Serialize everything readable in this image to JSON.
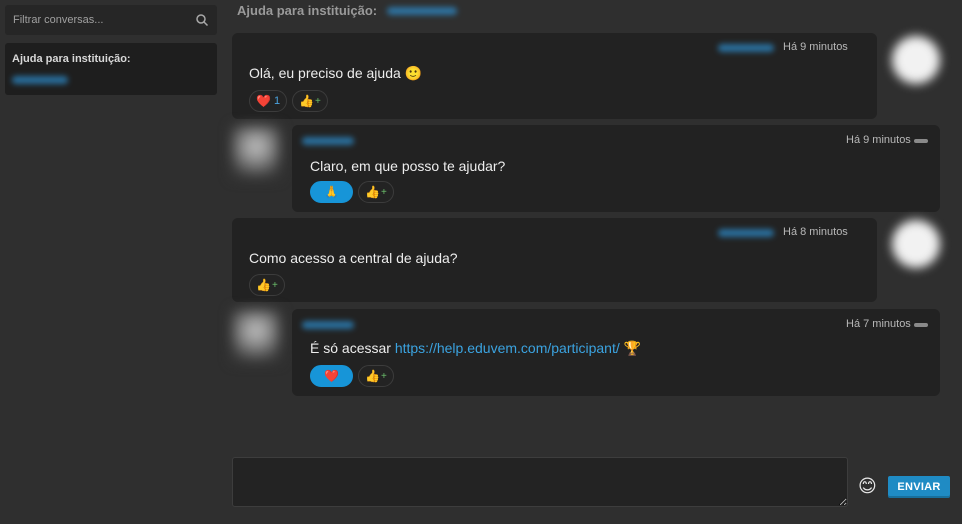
{
  "sidebar": {
    "search_placeholder": "Filtrar conversas...",
    "conversations": [
      {
        "title": "Ajuda para instituição:"
      }
    ]
  },
  "header": {
    "title": "Ajuda para instituição:"
  },
  "messages": [
    {
      "side": "right",
      "time": "Há 9 minutos",
      "text": "Olá, eu preciso de ajuda 🙂",
      "reactions": [
        {
          "emoji": "❤️",
          "count": "1",
          "active": false
        },
        {
          "emoji": "👍",
          "plus": "+",
          "active": false
        }
      ]
    },
    {
      "side": "left",
      "time": "Há 9 minutos",
      "text": "Claro, em que posso te ajudar?",
      "reactions": [
        {
          "emoji": "🙏",
          "active": true
        },
        {
          "emoji": "👍",
          "plus": "+",
          "active": false
        }
      ]
    },
    {
      "side": "right",
      "time": "Há 8 minutos",
      "text": "Como acesso a central de ajuda?",
      "reactions": [
        {
          "emoji": "👍",
          "plus": "+",
          "active": false
        }
      ]
    },
    {
      "side": "left",
      "time": "Há 7 minutos",
      "text_prefix": "É só acessar ",
      "link": "https://help.eduvem.com/participant/",
      "text_suffix": " 🏆",
      "reactions": [
        {
          "emoji": "❤️",
          "active": true
        },
        {
          "emoji": "👍",
          "plus": "+",
          "active": false
        }
      ]
    }
  ],
  "composer": {
    "emoji": "😊",
    "send_label": "ENVIAR"
  },
  "colors": {
    "accent": "#1795d8",
    "link": "#3ba3e0",
    "bubble": "#222222",
    "background": "#2f2f2f"
  }
}
